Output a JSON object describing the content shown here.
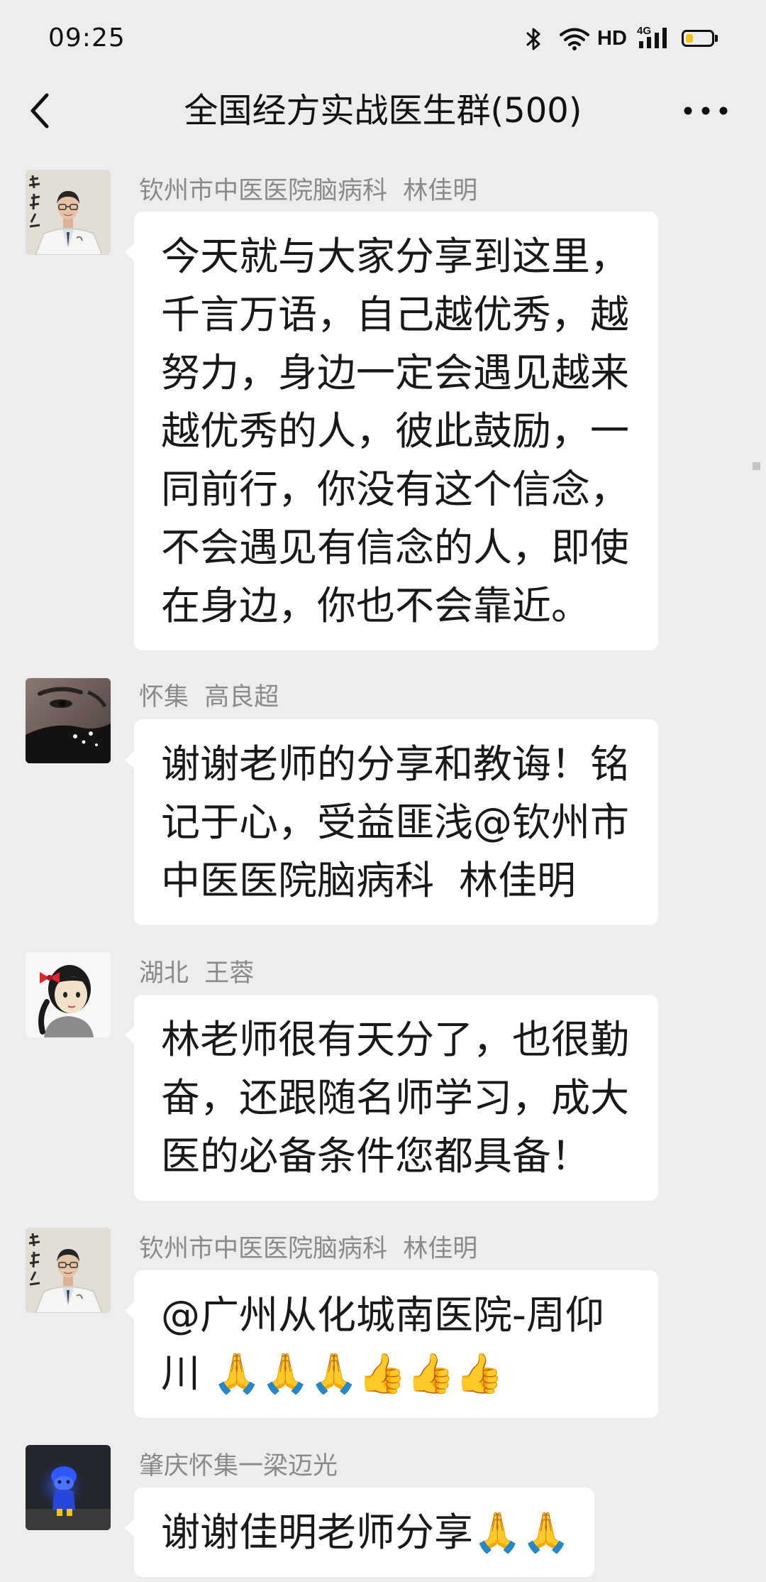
{
  "status_bar": {
    "time": "09:25",
    "hd_label": "HD",
    "network_label": "4G",
    "battery_level": 0.3,
    "icons": [
      "bluetooth-icon",
      "wifi-icon",
      "signal-bars-icon",
      "battery-icon"
    ]
  },
  "header": {
    "title": "全国经方实战医生群(500)",
    "back_icon": "back-arrow-icon",
    "more_icon": "more-dots-icon"
  },
  "messages": [
    {
      "sender": "钦州市中医医院脑病科  林佳明",
      "avatar": "doctor-photo-avatar",
      "text": "今天就与大家分享到这里，千言万语，自己越优秀，越努力，身边一定会遇见越来越优秀的人，彼此鼓励，一同前行，你没有这个信念，不会遇见有信念的人，即使在身边，你也不会靠近。"
    },
    {
      "sender": "怀集  高良超",
      "avatar": "face-closeup-avatar",
      "text": "谢谢老师的分享和教诲！铭记于心，受益匪浅@钦州市中医医院脑病科  林佳明"
    },
    {
      "sender": "湖北  王蓉",
      "avatar": "cartoon-girl-avatar",
      "text": "林老师很有天分了，也很勤奋，还跟随名师学习，成大医的必备条件您都具备！"
    },
    {
      "sender": "钦州市中医医院脑病科  林佳明",
      "avatar": "doctor-photo-avatar",
      "text": "@广州从化城南医院-周仰川 🙏🙏🙏👍👍👍"
    },
    {
      "sender": "肇庆怀集一梁迈光",
      "avatar": "blue-figure-avatar",
      "text": "谢谢佳明老师分享🙏🙏"
    }
  ],
  "colors": {
    "background": "#ededed",
    "bubble": "#ffffff",
    "sender_name": "#8a8a8a",
    "message_text": "#191919",
    "battery_fill": "#f2c21a"
  }
}
